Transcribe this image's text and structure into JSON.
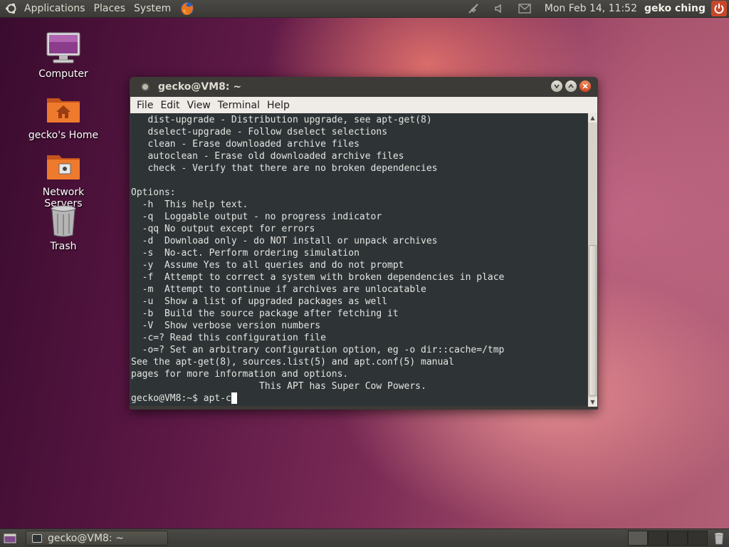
{
  "top_panel": {
    "menus": [
      "Applications",
      "Places",
      "System"
    ],
    "clock": "Mon Feb 14, 11:52",
    "user": "geko ching"
  },
  "desktop_icons": [
    {
      "label": "Computer",
      "icon": "computer-icon"
    },
    {
      "label": "gecko's Home",
      "icon": "home-folder-icon"
    },
    {
      "label": "Network Servers",
      "icon": "network-folder-icon"
    },
    {
      "label": "Trash",
      "icon": "trash-icon"
    }
  ],
  "terminal": {
    "title": "gecko@VM8: ~",
    "menu": [
      "File",
      "Edit",
      "View",
      "Terminal",
      "Help"
    ],
    "lines": [
      "   dist-upgrade - Distribution upgrade, see apt-get(8)",
      "   dselect-upgrade - Follow dselect selections",
      "   clean - Erase downloaded archive files",
      "   autoclean - Erase old downloaded archive files",
      "   check - Verify that there are no broken dependencies",
      "",
      "Options:",
      "  -h  This help text.",
      "  -q  Loggable output - no progress indicator",
      "  -qq No output except for errors",
      "  -d  Download only - do NOT install or unpack archives",
      "  -s  No-act. Perform ordering simulation",
      "  -y  Assume Yes to all queries and do not prompt",
      "  -f  Attempt to correct a system with broken dependencies in place",
      "  -m  Attempt to continue if archives are unlocatable",
      "  -u  Show a list of upgraded packages as well",
      "  -b  Build the source package after fetching it",
      "  -V  Show verbose version numbers",
      "  -c=? Read this configuration file",
      "  -o=? Set an arbitrary configuration option, eg -o dir::cache=/tmp",
      "See the apt-get(8), sources.list(5) and apt.conf(5) manual",
      "pages for more information and options.",
      "                       This APT has Super Cow Powers."
    ],
    "prompt": "gecko@VM8:~$ ",
    "input": "apt-c"
  },
  "bottom_panel": {
    "task_label": "gecko@VM8: ~"
  },
  "colors": {
    "terminal_bg": "#2e3436",
    "panel_bg": "#3c3b37",
    "accent": "#d2461f"
  }
}
